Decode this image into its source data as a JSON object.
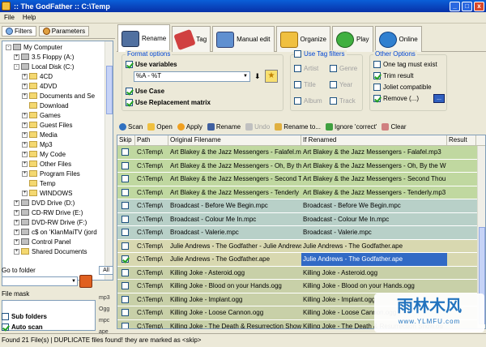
{
  "window": {
    "title": ":: The GodFather ::   C:\\Temp",
    "min": "_",
    "max": "□",
    "close": "x"
  },
  "menu": [
    "File",
    "Help"
  ],
  "left_tabs": {
    "filters": "Filters",
    "parameters": "Parameters"
  },
  "tree": [
    {
      "label": "My Computer",
      "level": 0,
      "kind": "pc",
      "exp": "-"
    },
    {
      "label": "3.5 Floppy (A:)",
      "level": 1,
      "kind": "drive",
      "exp": "+"
    },
    {
      "label": "Local Disk (C:)",
      "level": 1,
      "kind": "drive",
      "exp": "-"
    },
    {
      "label": "4CD",
      "level": 2,
      "kind": "folder",
      "exp": "+"
    },
    {
      "label": "4DVD",
      "level": 2,
      "kind": "folder",
      "exp": "+"
    },
    {
      "label": "Documents and Se",
      "level": 2,
      "kind": "folder",
      "exp": "+"
    },
    {
      "label": "Download",
      "level": 2,
      "kind": "folder",
      "exp": ""
    },
    {
      "label": "Games",
      "level": 2,
      "kind": "folder",
      "exp": "+"
    },
    {
      "label": "Guest Files",
      "level": 2,
      "kind": "folder",
      "exp": "+"
    },
    {
      "label": "Media",
      "level": 2,
      "kind": "folder",
      "exp": "+"
    },
    {
      "label": "Mp3",
      "level": 2,
      "kind": "folder",
      "exp": "+"
    },
    {
      "label": "My Code",
      "level": 2,
      "kind": "folder",
      "exp": "+"
    },
    {
      "label": "Other Files",
      "level": 2,
      "kind": "folder",
      "exp": "+"
    },
    {
      "label": "Program Files",
      "level": 2,
      "kind": "folder",
      "exp": "+"
    },
    {
      "label": "Temp",
      "level": 2,
      "kind": "folder",
      "exp": ""
    },
    {
      "label": "WINDOWS",
      "level": 2,
      "kind": "folder",
      "exp": "+"
    },
    {
      "label": "DVD Drive (D:)",
      "level": 1,
      "kind": "drive",
      "exp": "+"
    },
    {
      "label": "CD-RW Drive (E:)",
      "level": 1,
      "kind": "drive",
      "exp": "+"
    },
    {
      "label": "DVD-RW Drive (F:)",
      "level": 1,
      "kind": "drive",
      "exp": "+"
    },
    {
      "label": "c$ on 'KlanMaiTV (jord",
      "level": 1,
      "kind": "drive",
      "exp": "+"
    },
    {
      "label": "Control Panel",
      "level": 1,
      "kind": "drive",
      "exp": "+"
    },
    {
      "label": "Shared Documents",
      "level": 1,
      "kind": "folder",
      "exp": "+"
    }
  ],
  "goto": {
    "label": "Go to folder",
    "value": "",
    "all": "All"
  },
  "extensions": [
    "mp3",
    "Ogg",
    "mpc",
    "ape"
  ],
  "filemask": {
    "label": "File mask",
    "value": ""
  },
  "left_checks": {
    "subfolders": "Sub folders",
    "autoscan": "Auto scan"
  },
  "tabs": [
    "Rename",
    "Tag",
    "Manual edit",
    "Organize",
    "Play",
    "Online"
  ],
  "format_options": {
    "legend": "Format options",
    "use_variables": "Use variables",
    "pattern": "%A - %T",
    "use_case": "Use Case",
    "use_replacement": "Use Replacement matrix",
    "arrow": "▼",
    "download_glyph": "⬇",
    "star_glyph": "★"
  },
  "tag_filters": {
    "legend": "Use Tag filters",
    "fields": [
      "Artist",
      "Genre",
      "Title",
      "Year",
      "Album",
      "Track"
    ]
  },
  "other_options": {
    "legend": "Other Options",
    "one_tag": "One tag must exist",
    "trim": "Trim result",
    "joliet": "Joliet compatible",
    "remove": "Remove (...)",
    "dots": "..."
  },
  "toolbar": [
    "Scan",
    "Open",
    "Apply",
    "Rename",
    "Undo",
    "Rename to...",
    "Ignore 'correct'",
    "Clear"
  ],
  "grid": {
    "headers": [
      "Skip",
      "Path",
      "Original Filename",
      "If Renamed",
      "Result"
    ],
    "rows": [
      {
        "skip": false,
        "path": "C:\\Temp\\",
        "orig": "Art Blakey & the Jazz Messengers - Falafel.mi",
        "ren": "Art Blakey & the Jazz Messengers - Falafel.mp3",
        "color": "#c0d8a0"
      },
      {
        "skip": false,
        "path": "C:\\Temp\\",
        "orig": "Art Blakey & the Jazz Messengers - Oh, By th",
        "ren": "Art Blakey & the Jazz Messengers - Oh, By the W",
        "color": "#c0d8a0"
      },
      {
        "skip": false,
        "path": "C:\\Temp\\",
        "orig": "Art Blakey & the Jazz Messengers - Second T",
        "ren": "Art Blakey & the Jazz Messengers - Second Thou",
        "color": "#c0d8a0"
      },
      {
        "skip": false,
        "path": "C:\\Temp\\",
        "orig": "Art Blakey & the Jazz Messengers - Tenderly",
        "ren": "Art Blakey & the Jazz Messengers - Tenderly.mp3",
        "color": "#c0d8a0"
      },
      {
        "skip": false,
        "path": "C:\\Temp\\",
        "orig": "Broadcast - Before We Begin.mpc",
        "ren": "Broadcast - Before We Begin.mpc",
        "color": "#b8d0c8"
      },
      {
        "skip": false,
        "path": "C:\\Temp\\",
        "orig": "Broadcast - Colour Me In.mpc",
        "ren": "Broadcast - Colour Me In.mpc",
        "color": "#b8d0c8"
      },
      {
        "skip": false,
        "path": "C:\\Temp\\",
        "orig": "Broadcast - Valerie.mpc",
        "ren": "Broadcast - Valerie.mpc",
        "color": "#b8d0c8"
      },
      {
        "skip": false,
        "path": "C:\\Temp\\",
        "orig": "Julie Andrews - The Godfather - Julie Andrews",
        "ren": "Julie Andrews - The Godfather.ape",
        "color": "#d8d8b0"
      },
      {
        "skip": true,
        "path": "C:\\Temp\\",
        "orig": "Julie Andrews - The Godfather.ape",
        "ren": "Julie Andrews - The Godfather.ape",
        "color": "#d8d8b0",
        "selected": true
      },
      {
        "skip": false,
        "path": "C:\\Temp\\",
        "orig": "Killing Joke - Asteroid.ogg",
        "ren": "Killing Joke - Asteroid.ogg",
        "color": "#c8d0a8"
      },
      {
        "skip": false,
        "path": "C:\\Temp\\",
        "orig": "Killing Joke - Blood on your Hands.ogg",
        "ren": "Killing Joke - Blood on your Hands.ogg",
        "color": "#c8d0a8"
      },
      {
        "skip": false,
        "path": "C:\\Temp\\",
        "orig": "Killing Joke - Implant.ogg",
        "ren": "Killing Joke - Implant.ogg",
        "color": "#c8d0a8"
      },
      {
        "skip": false,
        "path": "C:\\Temp\\",
        "orig": "Killing Joke - Loose Cannon.ogg",
        "ren": "Killing Joke - Loose Cannon.ogg",
        "color": "#c8d0a8"
      },
      {
        "skip": false,
        "path": "C:\\Temp\\",
        "orig": "Killing Joke - The Death & Resurrection Show",
        "ren": "Killing Joke - The Death & Resurrection Show.og",
        "color": "#c8d0a8"
      }
    ]
  },
  "status": "Found 21 File(s) | DUPLICATE files found! they are marked as <skip>",
  "watermark": {
    "big": "雨林木风",
    "small": "www.YLMFU.com"
  }
}
